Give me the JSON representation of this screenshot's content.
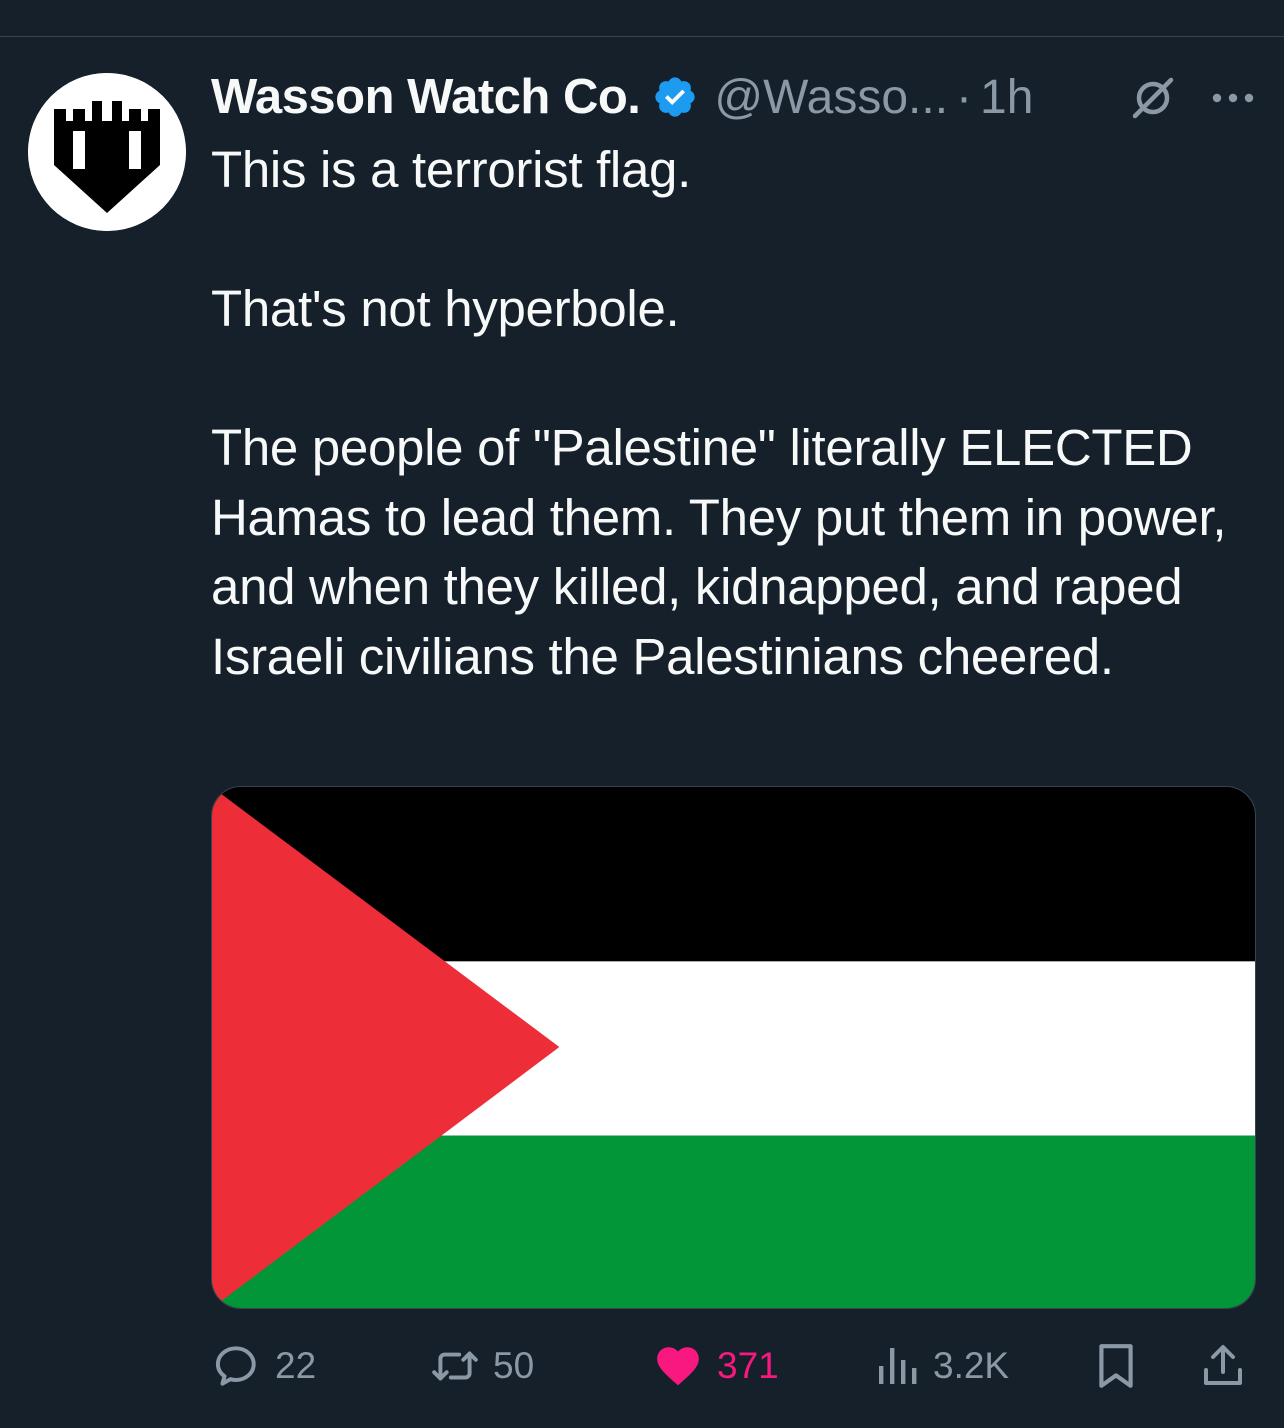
{
  "tweet": {
    "author": {
      "display_name": "Wasson Watch Co.",
      "handle": "@Wasso...",
      "verified": true,
      "avatar_icon": "castle-tower-logo"
    },
    "separator": "·",
    "timestamp": "1h",
    "text": {
      "line1": "This is a terrorist flag.",
      "line2": "That's not hyperbole.",
      "line3": "The people of \"Palestine\" literally ELECTED Hamas to lead them. They put them in power, and when they killed, kidnapped, and raped Israeli civilians the Palestinians cheered."
    },
    "media": {
      "type": "image",
      "subject": "flag",
      "colors": {
        "top_stripe": "#000000",
        "middle_stripe": "#ffffff",
        "bottom_stripe": "#039638",
        "triangle": "#ed2e38"
      }
    },
    "actions": {
      "replies": "22",
      "reposts": "50",
      "likes": "371",
      "views": "3.2K"
    }
  },
  "theme": {
    "background": "#15202b",
    "text": "#f7f9f9",
    "secondary": "#8b98a5",
    "verified_blue": "#1d9bf0",
    "like_pink": "#f91880"
  }
}
